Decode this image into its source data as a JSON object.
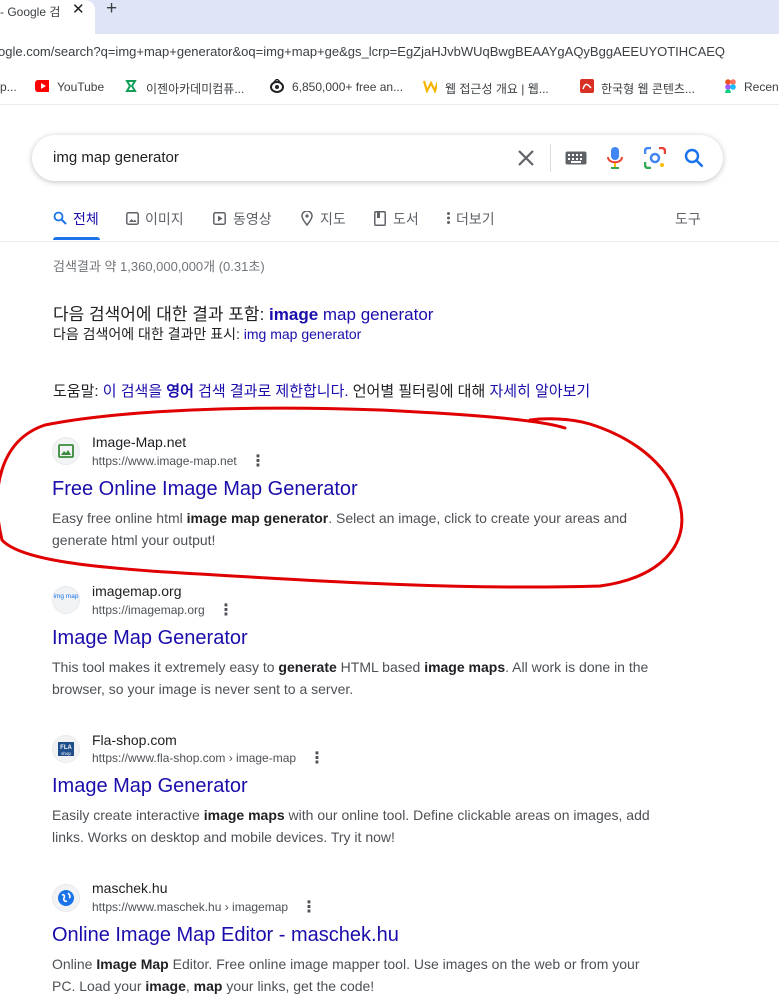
{
  "browser": {
    "tab_title": "- Google 검",
    "close_glyph": "✕",
    "new_tab_glyph": "+",
    "url": "ogle.com/search?q=img+map+generator&oq=img+map+ge&gs_lcrp=EgZjaHJvbWUqBwgBEAAYgAQyBggAEEUYOTIHCAEQ"
  },
  "bookmarks": [
    {
      "label": "p...",
      "icon": "folder-icon"
    },
    {
      "label": "YouTube",
      "icon": "youtube-icon",
      "color": "#ff0000"
    },
    {
      "label": "이젠아카데미컴퓨...",
      "icon": "academy-icon",
      "color": "#0f9d58"
    },
    {
      "label": "6,850,000+ free an...",
      "icon": "eye-icon",
      "color": "#202124"
    },
    {
      "label": "웹 접근성 개요 | 웹...",
      "icon": "w-icon",
      "color": "#f4b400"
    },
    {
      "label": "한국형 웹 콘텐츠...",
      "icon": "pdf-icon",
      "color": "#d93025"
    },
    {
      "label": "Recent",
      "icon": "figma-icon",
      "color": "#f24e1e"
    }
  ],
  "search": {
    "query": "img map generator"
  },
  "tabs": [
    {
      "label": "전체",
      "icon": "search-icon",
      "active": true
    },
    {
      "label": "이미지",
      "icon": "image-icon"
    },
    {
      "label": "동영상",
      "icon": "video-icon"
    },
    {
      "label": "지도",
      "icon": "map-pin-icon"
    },
    {
      "label": "도서",
      "icon": "book-icon"
    },
    {
      "label": "더보기",
      "icon": "more-vert-icon"
    }
  ],
  "tools_label": "도구",
  "stats": "검색결과 약 1,360,000,000개 (0.31초)",
  "spelling": {
    "including_prefix": "다음 검색어에 대한 결과 포함: ",
    "including_bold": "image",
    "including_rest": " map generator",
    "only_prefix": "다음 검색어에 대한 결과만 표시: ",
    "only_link": "img map generator"
  },
  "tip": {
    "prefix": "도움말: ",
    "link1_a": "이 검색을 ",
    "link1_b": "영어",
    "link1_c": " 검색 결과로 제한합니다.",
    "middle": " 언어별 필터링에 대해 ",
    "link2": "자세히 알아보기"
  },
  "results": [
    {
      "site": "Image-Map.net",
      "cite": "https://www.image-map.net",
      "title": "Free Online Image Map Generator",
      "snippet_html": "Easy free online html <b>image map generator</b>. Select an image, click to create your areas and generate html your output!",
      "favicon": "image-map-favicon"
    },
    {
      "site": "imagemap.org",
      "cite": "https://imagemap.org",
      "title": "Image Map Generator",
      "snippet_html": "This tool makes it extremely easy to <b>generate</b> HTML based <b>image maps</b>. All work is done in the browser, so your image is never sent to a server.",
      "favicon": "imagemap-org-favicon",
      "favicon_text": "img map"
    },
    {
      "site": "Fla-shop.com",
      "cite": "https://www.fla-shop.com › image-map",
      "title": "Image Map Generator",
      "snippet_html": "Easily create interactive <b>image maps</b> with our online tool. Define clickable areas on images, add links. Works on desktop and mobile devices. Try it now!",
      "favicon": "fla-shop-favicon",
      "favicon_text": "FLA shop"
    },
    {
      "site": "maschek.hu",
      "cite": "https://www.maschek.hu › imagemap",
      "title": "Online Image Map Editor - maschek.hu",
      "snippet_html": "Online <b>Image Map</b> Editor. Free online image mapper tool. Use images on the web or from your PC. Load your <b>image</b>, <b>map</b> your links, get the code!",
      "favicon": "globe-icon"
    }
  ],
  "more_glyph": "⋮",
  "colors": {
    "link": "#1a0dab",
    "annotation": "#e00000",
    "accent": "#1a73e8"
  }
}
